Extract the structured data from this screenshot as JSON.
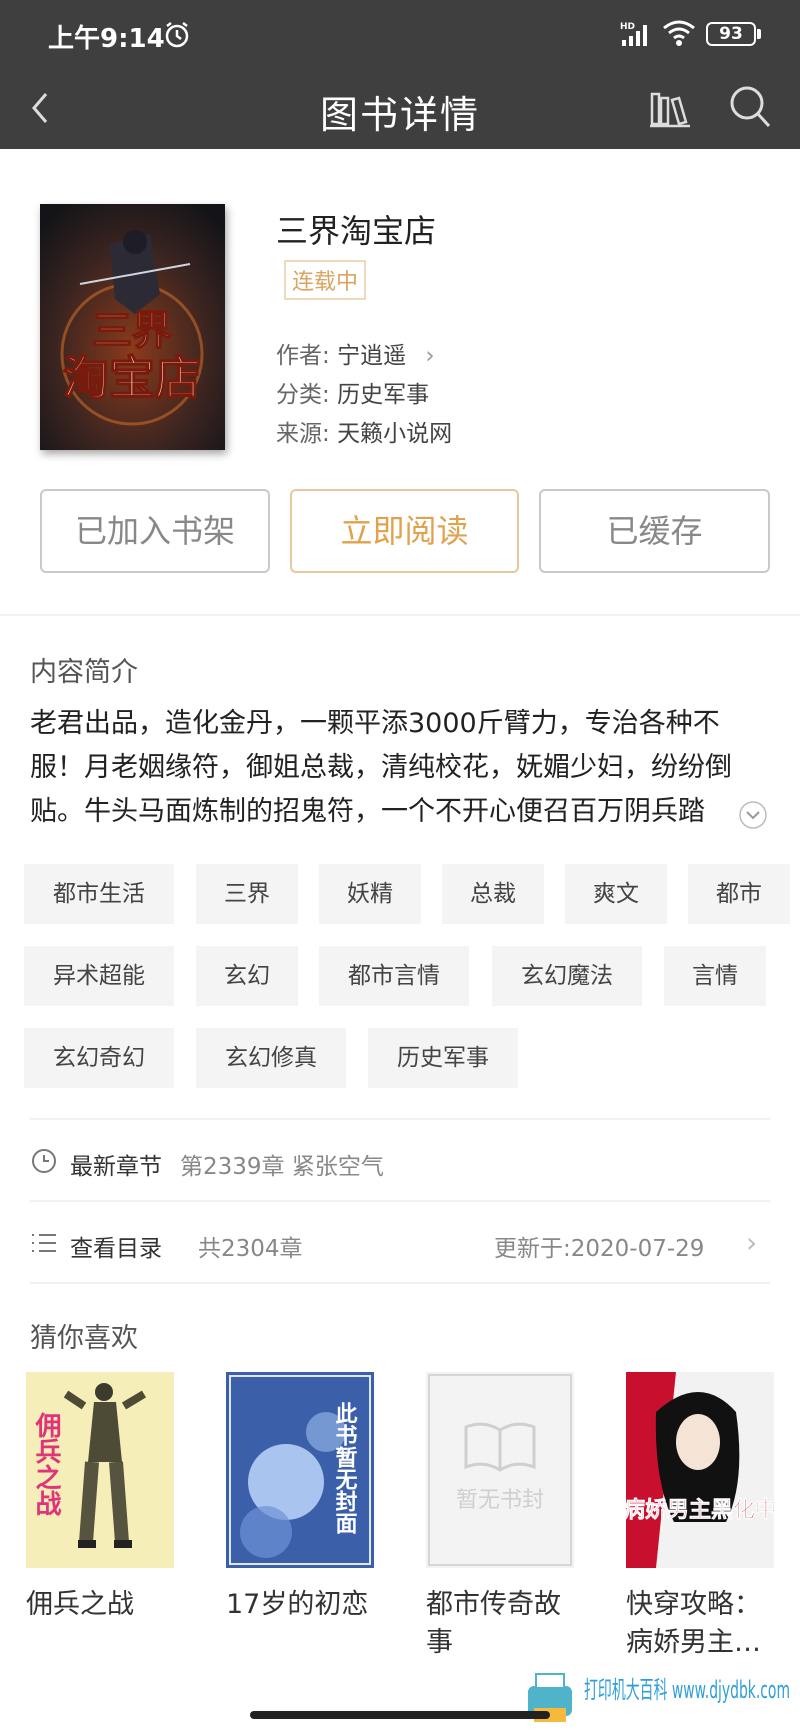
{
  "status_bar": {
    "time": "上午9:14",
    "network": "HD",
    "battery": "93"
  },
  "nav": {
    "title": "图书详情"
  },
  "book": {
    "title": "三界淘宝店",
    "status": "连载中",
    "author_label": "作者:",
    "author": "宁逍遥",
    "category_label": "分类:",
    "category": "历史军事",
    "source_label": "来源:",
    "source": "天籁小说网",
    "cover_text": "三界淘宝店"
  },
  "actions": {
    "shelf": "已加入书架",
    "read": "立即阅读",
    "cache": "已缓存"
  },
  "intro": {
    "heading": "内容简介",
    "text": "老君出品，造化金丹，一颗平添3000斤臂力，专治各种不服！月老姻缘符，御姐总裁，清纯校花，妩媚少妇，纷纷倒贴。牛头马面炼制的招鬼符，一个不开心便召百万阴兵踏"
  },
  "tags": [
    "都市生活",
    "三界",
    "妖精",
    "总裁",
    "爽文",
    "都市",
    "异术超能",
    "玄幻",
    "都市言情",
    "玄幻魔法",
    "言情",
    "玄幻奇幻",
    "玄幻修真",
    "历史军事"
  ],
  "latest": {
    "label": "最新章节",
    "value": "第2339章 紧张空气"
  },
  "catalog": {
    "label": "查看目录",
    "count": "共2304章",
    "updated": "更新于:2020-07-29"
  },
  "recommend": {
    "heading": "猜你喜欢",
    "books": [
      {
        "title": "佣兵之战",
        "cover_text": "佣兵之战"
      },
      {
        "title": "17岁的初恋",
        "cover_text": "此书暂无封面"
      },
      {
        "title": "都市传奇故事",
        "cover_text": "暂无书封"
      },
      {
        "title": "快穿攻略：病娇男主…",
        "cover_text": "病娇男主黑化中"
      }
    ]
  },
  "watermark": "打印机大百科 www.djydbk.com",
  "colors": {
    "topbar": "#3f3f3f",
    "accent": "#e0a24d",
    "tag_bg": "#f4f4f4"
  }
}
